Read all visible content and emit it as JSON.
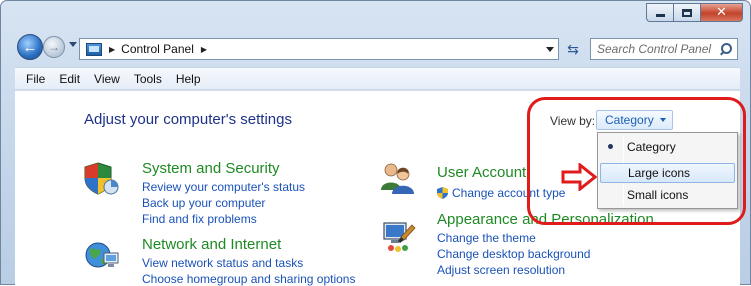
{
  "window": {
    "caption_buttons": [
      "minimize",
      "maximize",
      "close"
    ]
  },
  "nav": {
    "breadcrumb": "Control Panel",
    "search_placeholder": "Search Control Panel"
  },
  "menu": {
    "items": [
      "File",
      "Edit",
      "View",
      "Tools",
      "Help"
    ]
  },
  "main": {
    "heading": "Adjust your computer's settings",
    "view_by_label": "View by:",
    "view_by_value": "Category",
    "view_options": [
      "Category",
      "Large icons",
      "Small icons"
    ],
    "selected_option": "Category",
    "highlighted_option": "Large icons"
  },
  "categories": [
    {
      "title": "System and Security",
      "icon": "shield-icon",
      "links": [
        "Review your computer's status",
        "Back up your computer",
        "Find and fix problems"
      ]
    },
    {
      "title": "Network and Internet",
      "icon": "globe-network-icon",
      "links": [
        "View network status and tasks",
        "Choose homegroup and sharing options"
      ]
    },
    {
      "title": "User Account",
      "icon": "users-icon",
      "links": [
        "Change account type"
      ]
    },
    {
      "title": "Appearance and Personalization",
      "icon": "display-brush-icon",
      "links": [
        "Change the theme",
        "Change desktop background",
        "Adjust screen resolution"
      ]
    }
  ],
  "colors": {
    "annotation": "#e01b1b",
    "link": "#1a52b8",
    "category_title": "#1e8a24",
    "heading": "#1e3287"
  }
}
